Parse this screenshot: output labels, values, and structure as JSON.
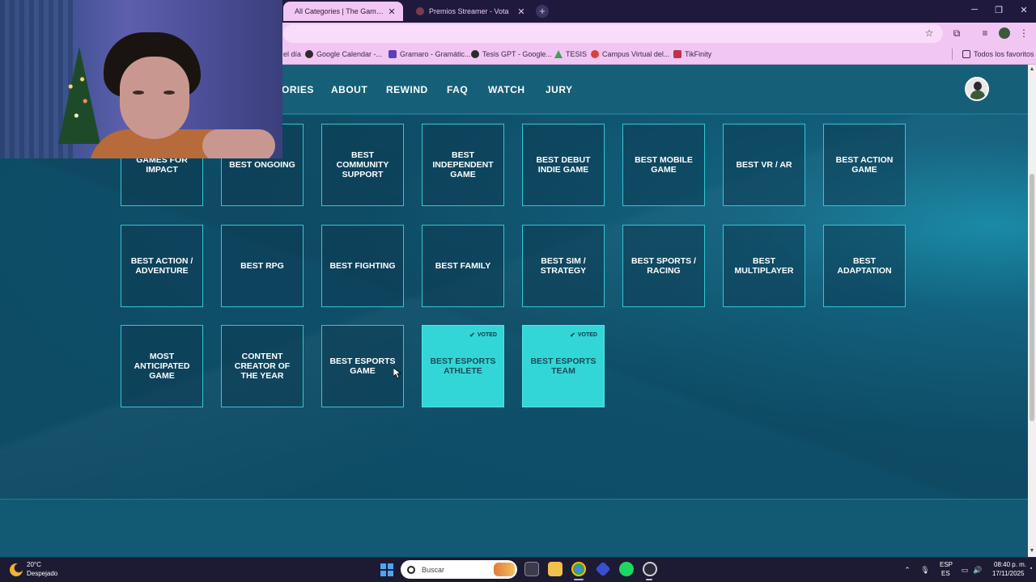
{
  "browser": {
    "tabs": [
      {
        "title": "All Categories | The Game Awards",
        "close": "✕",
        "active": true
      },
      {
        "title": "Premios Streamer - Vota",
        "close": "✕",
        "active": false
      }
    ],
    "new_tab": "+",
    "window_controls": {
      "minimize": "─",
      "maximize": "❐",
      "close": "✕"
    },
    "bookmarks": [
      {
        "label": "el día",
        "icon_color": "#ffffff"
      },
      {
        "label": "Google Calendar -...",
        "icon_color": "#2b2b2b"
      },
      {
        "label": "Gramaro - Gramátic...",
        "icon_color": "#5a3fc0"
      },
      {
        "label": "Tesis GPT - Google...",
        "icon_color": "#2b2b2b"
      },
      {
        "label": "TESIS",
        "icon_color": "#3fa34d"
      },
      {
        "label": "Campus Virtual del...",
        "icon_color": "#d94040"
      },
      {
        "label": "TikFinity",
        "icon_color": "#c0304a"
      }
    ],
    "all_bookmarks_label": "Todos los favoritos"
  },
  "nav": {
    "items": [
      "ORIES",
      "ABOUT",
      "REWIND",
      "FAQ",
      "WATCH",
      "JURY"
    ]
  },
  "categories": {
    "voted_label": "VOTED",
    "rows": [
      [
        {
          "label": "GAMES FOR IMPACT",
          "voted": false
        },
        {
          "label": "BEST ONGOING",
          "voted": false
        },
        {
          "label": "BEST COMMUNITY SUPPORT",
          "voted": false
        },
        {
          "label": "BEST INDEPENDENT GAME",
          "voted": false
        },
        {
          "label": "BEST DEBUT INDIE GAME",
          "voted": false
        },
        {
          "label": "BEST MOBILE GAME",
          "voted": false
        },
        {
          "label": "BEST VR / AR",
          "voted": false
        },
        {
          "label": "BEST ACTION GAME",
          "voted": false
        }
      ],
      [
        {
          "label": "BEST ACTION / ADVENTURE",
          "voted": false
        },
        {
          "label": "BEST RPG",
          "voted": false
        },
        {
          "label": "BEST FIGHTING",
          "voted": false
        },
        {
          "label": "BEST FAMILY",
          "voted": false
        },
        {
          "label": "BEST SIM / STRATEGY",
          "voted": false
        },
        {
          "label": "BEST SPORTS / RACING",
          "voted": false
        },
        {
          "label": "BEST MULTIPLAYER",
          "voted": false
        },
        {
          "label": "BEST ADAPTATION",
          "voted": false
        }
      ],
      [
        {
          "label": "MOST ANTICIPATED GAME",
          "voted": false
        },
        {
          "label": "CONTENT CREATOR OF THE YEAR",
          "voted": false
        },
        {
          "label": "BEST ESPORTS GAME",
          "voted": false
        },
        {
          "label": "BEST ESPORTS ATHLETE",
          "voted": true
        },
        {
          "label": "BEST ESPORTS TEAM",
          "voted": true
        }
      ]
    ]
  },
  "taskbar": {
    "weather_temp": "20°C",
    "weather_desc": "Despejado",
    "search_placeholder": "Buscar",
    "lang_primary": "ESP",
    "lang_secondary": "ES",
    "time": "08:40 p. m.",
    "date": "17/11/2025"
  },
  "colors": {
    "card_border": "#33c7d3",
    "voted_fill": "#33d6d6",
    "page_bg": "#0f4a63",
    "chrome_pink": "#f2c6f2"
  }
}
